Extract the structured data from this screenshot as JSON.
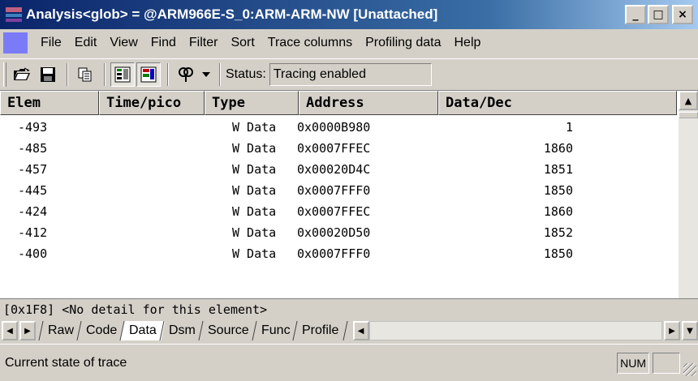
{
  "window": {
    "title": "Analysis<glob> = @ARM966E-S_0:ARM-ARM-NW [Unattached]",
    "controls": {
      "minimize": "_",
      "maximize": "□",
      "close": "×"
    }
  },
  "menu": {
    "items": [
      "File",
      "Edit",
      "View",
      "Find",
      "Filter",
      "Sort",
      "Trace columns",
      "Profiling data",
      "Help"
    ]
  },
  "toolbar": {
    "icons": [
      "open-folder-icon",
      "save-icon",
      "copy-icon",
      "filter-view-icon",
      "colored-view-icon",
      "trace-options-icon",
      "dropdown-arrow-icon"
    ],
    "status_label": "Status:",
    "status_value": "Tracing enabled"
  },
  "grid": {
    "columns": [
      "Elem",
      "Time/pico",
      "Type",
      "Address",
      "Data/Dec"
    ],
    "rows": [
      {
        "elem": "-493",
        "time": "",
        "type": "W Data",
        "address": "0x0000B980",
        "data": "1"
      },
      {
        "elem": "-485",
        "time": "",
        "type": "W Data",
        "address": "0x0007FFEC",
        "data": "1860"
      },
      {
        "elem": "-457",
        "time": "",
        "type": "W Data",
        "address": "0x00020D4C",
        "data": "1851"
      },
      {
        "elem": "-445",
        "time": "",
        "type": "W Data",
        "address": "0x0007FFF0",
        "data": "1850"
      },
      {
        "elem": "-424",
        "time": "",
        "type": "W Data",
        "address": "0x0007FFEC",
        "data": "1860"
      },
      {
        "elem": "-412",
        "time": "",
        "type": "W Data",
        "address": "0x00020D50",
        "data": "1852"
      },
      {
        "elem": "-400",
        "time": "",
        "type": "W Data",
        "address": "0x0007FFF0",
        "data": "1850"
      }
    ]
  },
  "detail": "[0x1F8] <No detail for this element>",
  "tabs": {
    "items": [
      "Raw",
      "Code",
      "Data",
      "Dsm",
      "Source",
      "Func",
      "Profile"
    ],
    "active": "Data"
  },
  "statusbar": {
    "text": "Current state of trace",
    "indicator": "NUM"
  }
}
